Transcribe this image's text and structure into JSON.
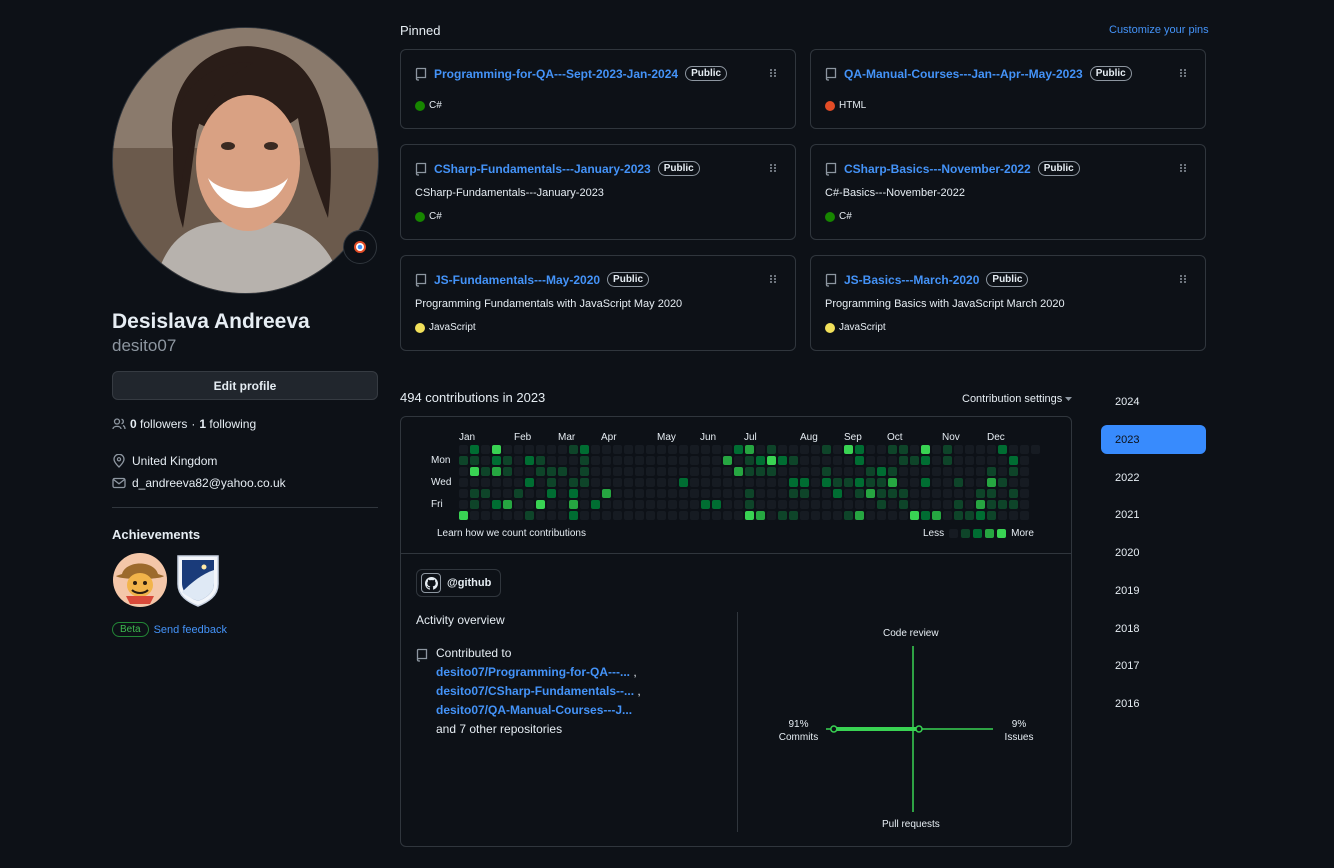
{
  "profile": {
    "full_name": "Desislava Andreeva",
    "username": "desito07",
    "edit_label": "Edit profile",
    "followers_count": "0",
    "followers_label": "followers",
    "separator": "·",
    "following_count": "1",
    "following_label": "following",
    "location": "United Kingdom",
    "email": "d_andreeva82@yahoo.co.uk"
  },
  "achievements": {
    "title": "Achievements",
    "badges": [
      "quickdraw-cowboy-badge",
      "arctic-code-vault-badge"
    ],
    "beta_label": "Beta",
    "feedback_label": "Send feedback"
  },
  "pinned": {
    "title": "Pinned",
    "customize_label": "Customize your pins",
    "repos": [
      {
        "name": "Programming-for-QA---Sept-2023-Jan-2024",
        "visibility": "Public",
        "description": "",
        "language": "C#",
        "language_color": "#178600"
      },
      {
        "name": "QA-Manual-Courses---Jan--Apr--May-2023",
        "visibility": "Public",
        "description": "",
        "language": "HTML",
        "language_color": "#e34c26"
      },
      {
        "name": "CSharp-Fundamentals---January-2023",
        "visibility": "Public",
        "description": "CSharp-Fundamentals---January-2023",
        "language": "C#",
        "language_color": "#178600"
      },
      {
        "name": "CSharp-Basics---November-2022",
        "visibility": "Public",
        "description": "C#-Basics---November-2022",
        "language": "C#",
        "language_color": "#178600"
      },
      {
        "name": "JS-Fundamentals---May-2020",
        "visibility": "Public",
        "description": "Programming Fundamentals with JavaScript May 2020",
        "language": "JavaScript",
        "language_color": "#f1e05a"
      },
      {
        "name": "JS-Basics---March-2020",
        "visibility": "Public",
        "description": "Programming Basics with JavaScript March 2020",
        "language": "JavaScript",
        "language_color": "#f1e05a"
      }
    ]
  },
  "contributions": {
    "title": "494 contributions in 2023",
    "settings_label": "Contribution settings",
    "months": [
      "Jan",
      "Feb",
      "Mar",
      "Apr",
      "May",
      "Jun",
      "Jul",
      "Aug",
      "Sep",
      "Oct",
      "Nov",
      "Dec"
    ],
    "day_labels": [
      "Mon",
      "Wed",
      "Fri"
    ],
    "learn_label": "Learn how we count contributions",
    "less_label": "Less",
    "more_label": "More",
    "level_colors": [
      "#161b22",
      "#0e4429",
      "#006d32",
      "#26a641",
      "#39d353"
    ]
  },
  "activity": {
    "org_label": "@github",
    "title": "Activity overview",
    "contributed_to_label": "Contributed to",
    "repos": [
      "desito07/Programming-for-QA---...",
      "desito07/CSharp-Fundamentals--...",
      "desito07/QA-Manual-Courses---J..."
    ],
    "comma": ",",
    "others_label": "and 7 other repositories",
    "code_review_label": "Code review",
    "commits_pct": "91%",
    "commits_label": "Commits",
    "issues_pct": "9%",
    "issues_label": "Issues",
    "pull_requests_label": "Pull requests",
    "commits_value": 91,
    "issues_value": 9,
    "code_review_value": 0,
    "pull_requests_value": 0
  },
  "years": [
    "2024",
    "2023",
    "2022",
    "2021",
    "2020",
    "2019",
    "2018",
    "2017",
    "2016"
  ],
  "selected_year": "2023",
  "colors": {
    "accent": "#4493f8",
    "green": "#39d353"
  }
}
